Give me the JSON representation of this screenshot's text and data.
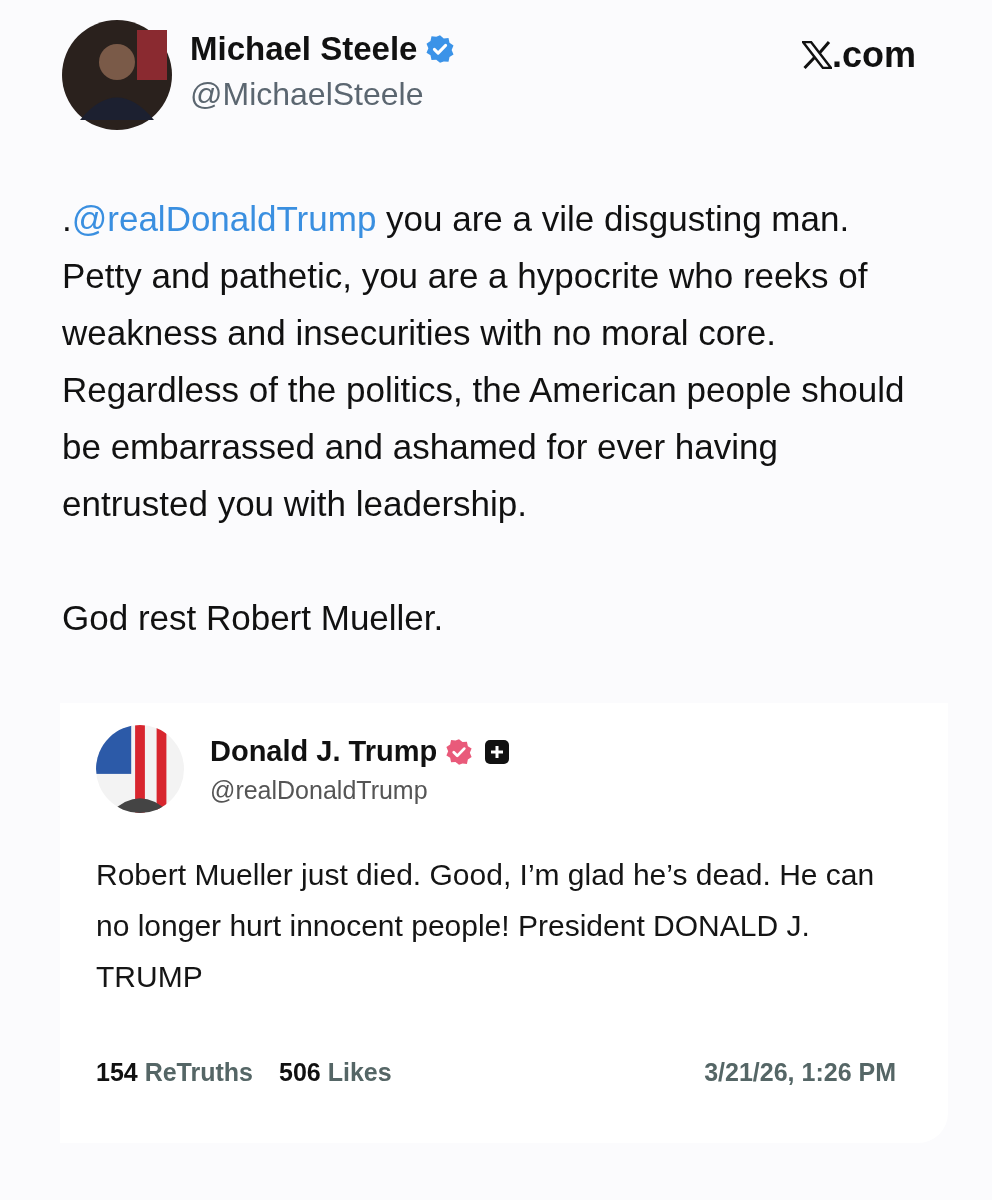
{
  "post": {
    "author": {
      "name": "Michael Steele",
      "handle": "@MichaelSteele",
      "verified": true
    },
    "site": ".com",
    "paragraphs": [
      {
        "parts": [
          {
            "kind": "text",
            "text": "."
          },
          {
            "kind": "mention",
            "text": "@realDonaldTrump"
          },
          {
            "kind": "text",
            "text": " you are a vile disgusting man. Petty and pathetic, you are a hypocrite who reeks of weakness and insecurities with no moral core. Regardless of the politics, the American people should be embarrassed and ashamed for ever having entrusted you with leadership."
          }
        ]
      },
      {
        "parts": [
          {
            "kind": "text",
            "text": "God rest Robert Mueller."
          }
        ]
      }
    ]
  },
  "quoted_post": {
    "author": {
      "name": "Donald J. Trump",
      "handle": "@realDonaldTrump",
      "verified": true
    },
    "text": "Robert Mueller just died. Good, I’m glad he’s dead. He can no longer hurt innocent people! President DONALD J. TRUMP",
    "stats": [
      "**154** ReTruths",
      "**506** Likes"
    ],
    "timestamp": "3/21/26, 1:26 PM"
  }
}
